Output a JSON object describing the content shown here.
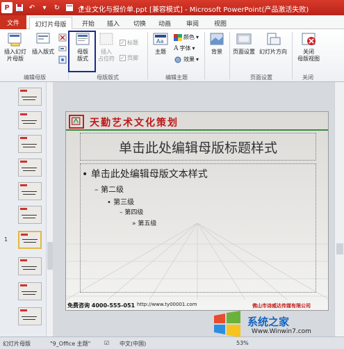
{
  "window": {
    "title": "企业文化与报价单.ppt [兼容模式] - Microsoft PowerPoint(产品激活失败)",
    "app_icon": "P"
  },
  "tabs": [
    {
      "label": "文件"
    },
    {
      "label": "幻灯片母版"
    },
    {
      "label": "开始"
    },
    {
      "label": "插入"
    },
    {
      "label": "切换"
    },
    {
      "label": "动画"
    },
    {
      "label": "审阅"
    },
    {
      "label": "视图"
    }
  ],
  "ribbon": {
    "insert_slide_master": "插入幻灯\n片母版",
    "insert_layout": "插入版式",
    "master_layout": "母版\n版式",
    "insert_placeholder": "插入\n占位符",
    "title_check": "标题",
    "footer_check": "页脚",
    "themes": "主题",
    "colors": "颜色",
    "fonts": "字体",
    "effects": "效果",
    "background": "背景",
    "page_setup": "页面设置",
    "slide_orientation": "幻灯片方向",
    "close_master_view": "关闭\n母版视图",
    "groups": {
      "edit_master": "编辑母版",
      "master_layout": "母版版式",
      "edit_theme": "编辑主题",
      "page_setup": "页面设置",
      "close": "关闭"
    }
  },
  "thumbnails": {
    "selected_number": "1"
  },
  "slide": {
    "brand": "天勤艺术文化策划",
    "title_placeholder": "单击此处编辑母版标题样式",
    "level1": "单击此处编辑母版文本样式",
    "level2": "第二级",
    "level3": "第三级",
    "level4": "第四级",
    "level5": "第五级",
    "footer_left": "免费咨询 4000-555-051",
    "footer_url": "http://www.ty00001.com",
    "footer_right": "佛山市诗威达传媒有限公司"
  },
  "statusbar": {
    "view_mode": "幻灯片母版",
    "theme": "\"9_Office 主题\"",
    "language": "中文(中国)",
    "zoom": "53%"
  },
  "watermark": {
    "text": "系统之家",
    "url": "Www.Winwin7.com"
  },
  "colors": {
    "title_bar": "#c8321f",
    "accent_red": "#c01818",
    "highlight_box": "#1b2a8a"
  }
}
